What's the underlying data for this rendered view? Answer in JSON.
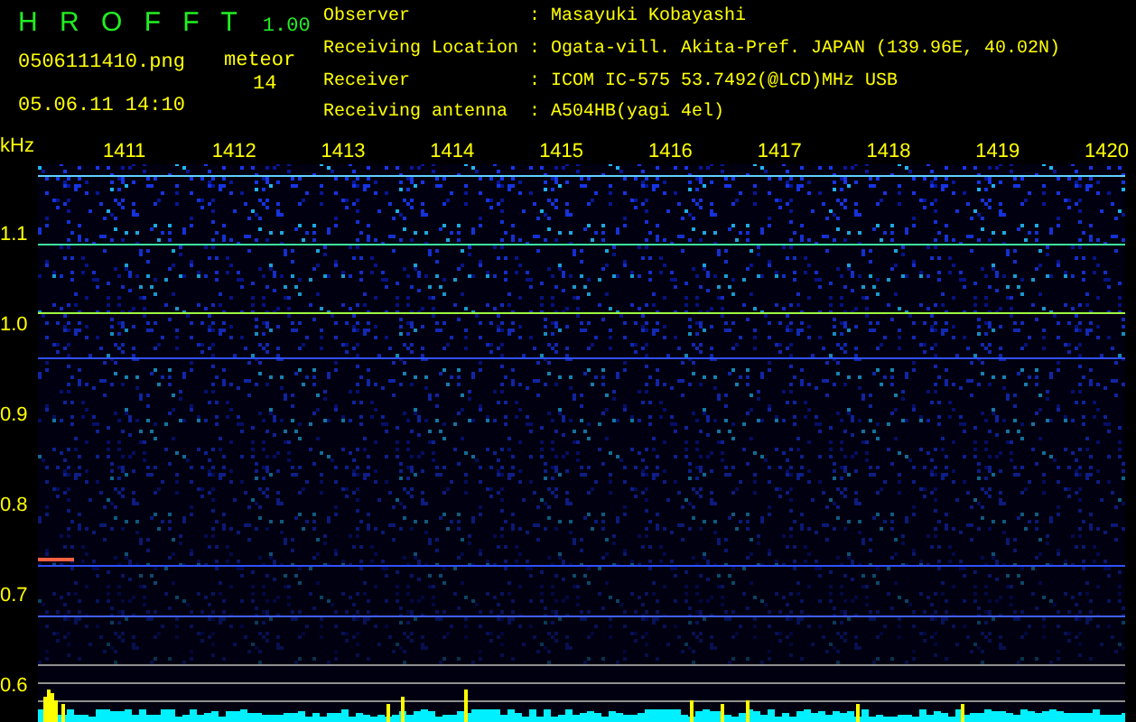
{
  "app": {
    "name": "H R O F F T",
    "version": "1.00"
  },
  "file": "0506111410.png",
  "datetime": "05.06.11 14:10",
  "meteor": {
    "label": "meteor",
    "count": "14"
  },
  "info": [
    {
      "label": "Observer",
      "separator": ":",
      "value": "Masayuki Kobayashi"
    },
    {
      "label": "Receiving Location",
      "separator": ":",
      "value": "Ogata-vill. Akita-Pref. JAPAN (139.96E, 40.02N)"
    },
    {
      "label": "Receiver",
      "separator": ":",
      "value": "ICOM IC-575 53.7492(@LCD)MHz USB"
    },
    {
      "label": "Receiving antenna",
      "separator": ":",
      "value": "A504HB(yagi 4el)"
    }
  ],
  "y_axis": {
    "unit": "kHz",
    "ticks": [
      "1.1",
      "1.0",
      "0.9",
      "0.8",
      "0.7",
      "0.6"
    ]
  },
  "x_axis": {
    "ticks": [
      "1411",
      "1412",
      "1413",
      "1414",
      "1415",
      "1416",
      "1417",
      "1418",
      "1419",
      "1420"
    ]
  }
}
